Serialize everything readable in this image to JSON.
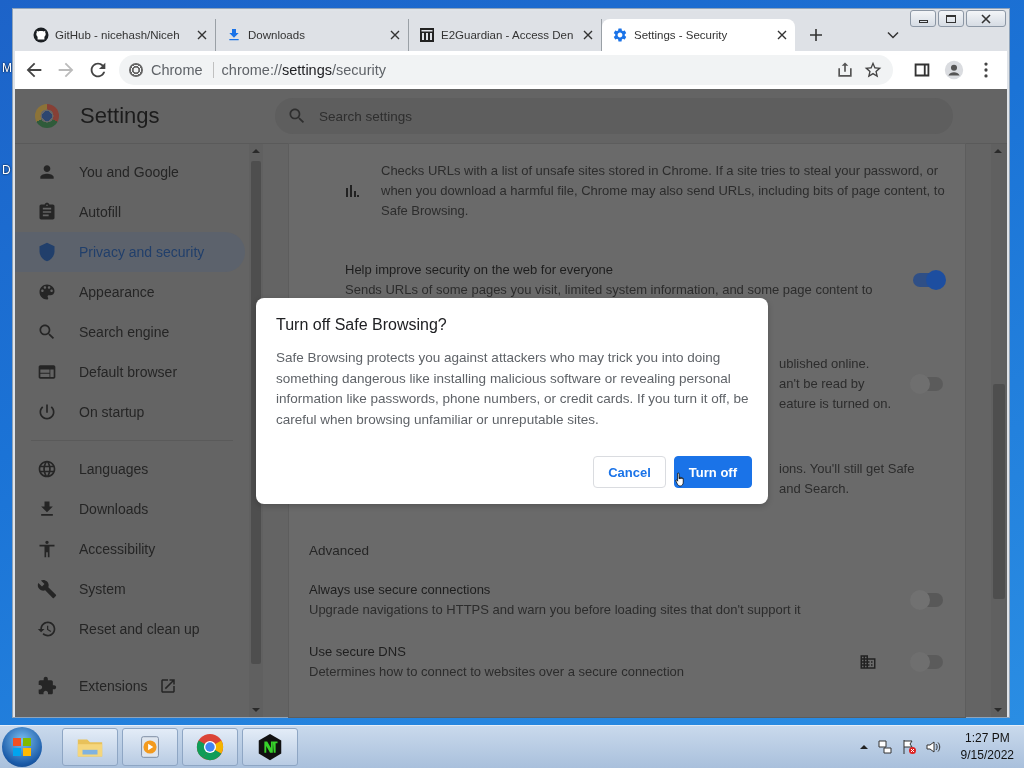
{
  "desktop": {
    "labels": [
      "M",
      "D"
    ]
  },
  "tabs": [
    {
      "title": "GitHub - nicehash/Niceh",
      "kind": "github",
      "selected": false
    },
    {
      "title": "Downloads",
      "kind": "download",
      "selected": false
    },
    {
      "title": "E2Guardian - Access Den",
      "kind": "bank",
      "selected": false
    },
    {
      "title": "Settings - Security",
      "kind": "gear",
      "selected": true
    }
  ],
  "toolbar": {
    "site_chip": "Chrome",
    "url_scheme": "chrome://",
    "url_host": "settings",
    "url_path": "/security"
  },
  "settings": {
    "title": "Settings",
    "search_placeholder": "Search settings"
  },
  "sidebar": {
    "groups": [
      [
        {
          "label": "You and Google",
          "kind": "person",
          "selected": false
        },
        {
          "label": "Autofill",
          "kind": "clipboard",
          "selected": false
        },
        {
          "label": "Privacy and security",
          "kind": "shield",
          "selected": true
        },
        {
          "label": "Appearance",
          "kind": "palette",
          "selected": false
        },
        {
          "label": "Search engine",
          "kind": "search",
          "selected": false
        },
        {
          "label": "Default browser",
          "kind": "browser",
          "selected": false
        },
        {
          "label": "On startup",
          "kind": "power",
          "selected": false
        }
      ],
      [
        {
          "label": "Languages",
          "kind": "globe",
          "selected": false
        },
        {
          "label": "Downloads",
          "kind": "download",
          "selected": false
        },
        {
          "label": "Accessibility",
          "kind": "accessibility",
          "selected": false
        },
        {
          "label": "System",
          "kind": "wrench",
          "selected": false
        },
        {
          "label": "Reset and clean up",
          "kind": "history",
          "selected": false
        }
      ]
    ],
    "extensions": {
      "label": "Extensions"
    }
  },
  "content": {
    "rows": [
      {
        "kind": "note",
        "text": "Checks URLs with a list of unsafe sites stored in Chrome. If a site tries to steal your password, or when you download a harmful file, Chrome may also send URLs, including bits of page content, to Safe Browsing."
      },
      {
        "kind": "subtoggle",
        "title": "Help improve security on the web for everyone",
        "description": "Sends URLs of some pages you visit, limited system information, and some page content to",
        "on": true
      },
      {
        "kind": "covered",
        "lines": [
          "ublished online.",
          "an't be read by",
          "eature is turned on."
        ],
        "on": false
      },
      {
        "kind": "covered",
        "lines": [
          "ions. You'll still get Safe",
          "and Search."
        ]
      },
      {
        "kind": "heading",
        "text": "Advanced"
      },
      {
        "kind": "toggle",
        "title": "Always use secure connections",
        "description": "Upgrade navigations to HTTPS and warn you before loading sites that don't support it",
        "on": false
      },
      {
        "kind": "toggle",
        "title": "Use secure DNS",
        "description": "Determines how to connect to websites over a secure connection",
        "on": false,
        "managed": true
      }
    ]
  },
  "dialog": {
    "title": "Turn off Safe Browsing?",
    "body": "Safe Browsing protects you against attackers who may trick you into doing something dangerous like installing malicious software or revealing personal information like passwords, phone numbers, or credit cards. If you turn it off, be careful when browsing unfamiliar or unreputable sites.",
    "buttons": [
      {
        "label": "Cancel",
        "kind": "secondary"
      },
      {
        "label": "Turn off",
        "kind": "primary"
      }
    ]
  },
  "taskbar": {
    "apps": [
      {
        "kind": "explorer"
      },
      {
        "kind": "media"
      },
      {
        "kind": "chrome"
      },
      {
        "kind": "nt"
      }
    ],
    "time": "1:27 PM",
    "date": "9/15/2022"
  }
}
